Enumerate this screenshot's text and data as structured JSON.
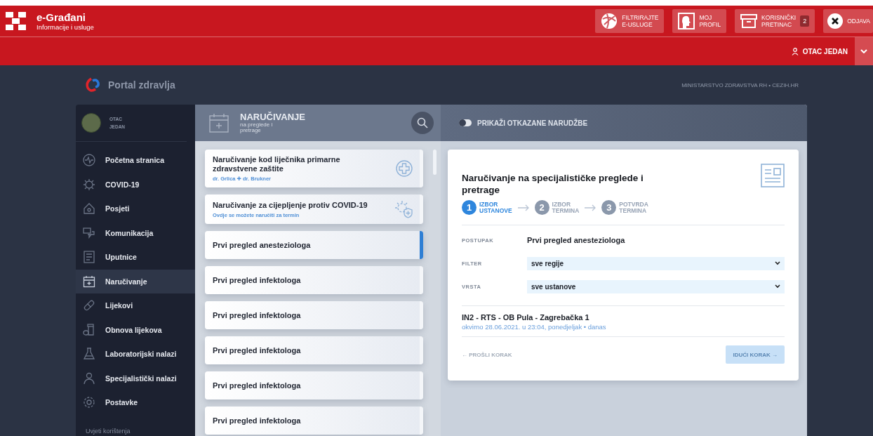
{
  "brand": {
    "title": "e-Građani",
    "subtitle": "Informacije i usluge"
  },
  "header_buttons": [
    {
      "kind": "globe",
      "lines": [
        "FILTRIRAJTE",
        "E-USLUGE"
      ]
    },
    {
      "kind": "profile",
      "lines": [
        "MOJ",
        "PROFIL"
      ]
    },
    {
      "kind": "box",
      "lines": [
        "KORISNIČKI",
        "PRETINAC"
      ],
      "badge": "2"
    },
    {
      "kind": "close",
      "lines": [
        "ODJAVA"
      ]
    }
  ],
  "user_bar": {
    "user": "OTAC JEDAN"
  },
  "portal": {
    "title": "Portal zdravlja",
    "ministry": "MINISTARSTVO ZDRAVSTVA RH • CEZIH.HR"
  },
  "sidebar": {
    "profile_lines": [
      "OTAC",
      "JEDAN"
    ],
    "items": [
      {
        "label": "Početna stranica",
        "kind": "pulse",
        "selected": false
      },
      {
        "label": "COVID-19",
        "kind": "virus",
        "selected": false
      },
      {
        "label": "Posjeti",
        "kind": "house",
        "selected": false
      },
      {
        "label": "Komunikacija",
        "kind": "chat",
        "selected": false
      },
      {
        "label": "Uputnice",
        "kind": "document",
        "selected": false
      },
      {
        "label": "Naručivanje",
        "kind": "calendar",
        "selected": true
      },
      {
        "label": "Lijekovi",
        "kind": "pill",
        "selected": false
      },
      {
        "label": "Obnova lijekova",
        "kind": "bottle",
        "selected": false
      },
      {
        "label": "Laboratorijski nalazi",
        "kind": "flask",
        "selected": false
      },
      {
        "label": "Specijalistički nalazi",
        "kind": "doctor",
        "selected": false
      },
      {
        "label": "Postavke",
        "kind": "gear",
        "selected": false
      }
    ],
    "footer": "Uvjeti korištenja"
  },
  "section": {
    "title": "NARUČIVANJE",
    "subtitle_lines": [
      "na preglede i",
      "pretrage"
    ]
  },
  "services": [
    {
      "title": "Naručivanje kod liječnika primarne zdravstvene zaštite",
      "subtitle": "dr. Grlica ✚ dr. Brukner",
      "kind": "plus",
      "selected": false
    },
    {
      "title": "Naručivanje za cijepljenje protiv COVID-19",
      "subtitle": "Ovdje se možete naručiti za termin",
      "kind": "vaccine",
      "selected": false
    },
    {
      "title": "Prvi pregled anesteziologa",
      "kind": "plain",
      "selected": true
    },
    {
      "title": "Prvi pregled infektologa",
      "kind": "plain",
      "selected": false
    },
    {
      "title": "Prvi pregled infektologa",
      "kind": "plain",
      "selected": false
    },
    {
      "title": "Prvi pregled infektologa",
      "kind": "plain",
      "selected": false
    },
    {
      "title": "Prvi pregled infektologa",
      "kind": "plain",
      "selected": false
    },
    {
      "title": "Prvi pregled infektologa",
      "kind": "plain",
      "selected": false
    }
  ],
  "toggle": {
    "label": "PRIKAŽI OTKAZANE NARUDŽBE",
    "on": false
  },
  "booking": {
    "title": "Naručivanje na specijalističke preglede i pretrage",
    "steps": [
      {
        "number": "1",
        "lines": [
          "IZBOR",
          "USTANOVE"
        ],
        "selected": true
      },
      {
        "number": "2",
        "lines": [
          "IZBOR",
          "TERMINA"
        ],
        "selected": false
      },
      {
        "number": "3",
        "lines": [
          "POTVRDA",
          "TERMINA"
        ],
        "selected": false
      }
    ],
    "procedure": {
      "label": "POSTUPAK",
      "value": "Prvi pregled anesteziologa"
    },
    "filters": [
      {
        "label": "FILTER",
        "value": "sve regije"
      },
      {
        "label": "VRSTA",
        "value": "sve ustanove"
      }
    ],
    "result": {
      "title": "IN2 - RTS - OB Pula - Zagrebačka 1",
      "detail": "okvirno 28.06.2021. u 23:04, ponedjeljak • danas"
    },
    "prev_button": {
      "label": "← PROŠLI KORAK",
      "disabled": true
    },
    "next_button": {
      "label": "IDUĆI KORAK →",
      "disabled": true
    }
  }
}
